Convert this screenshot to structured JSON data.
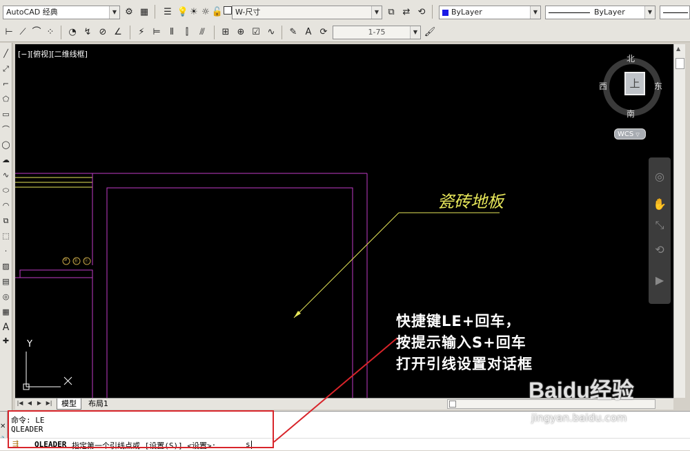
{
  "toolbar1": {
    "workspace": "AutoCAD 经典",
    "layer": "W-尺寸",
    "color": "ByLayer",
    "linetype": "ByLayer"
  },
  "toolbar2": {
    "dimstyle": "1-75"
  },
  "viewport": {
    "label": "[−][俯视][二维线框]",
    "compass": {
      "north": "北",
      "south": "南",
      "east": "东",
      "west": "西",
      "face": "上"
    },
    "wcs": "WCS",
    "axis_y": "Y",
    "leader_text": "瓷砖地板",
    "circle_labels": [
      "⑩",
      "Ⓡ",
      "Ⓣ"
    ],
    "annotation_lines": [
      "快捷键LE+回车，",
      "按提示输入S+回车",
      "打开引线设置对话框"
    ]
  },
  "tabs": {
    "model": "模型",
    "layout1": "布局1"
  },
  "command": {
    "history": [
      "命令: LE",
      "QLEADER"
    ],
    "prompt_name": "QLEADER",
    "prompt_text": "指定第一个引线点或 [设置(S)] <设置>:",
    "input_value": "s"
  },
  "watermark": {
    "brand": "Baidu经验",
    "url": "jingyan.baidu.com"
  },
  "colors": {
    "magenta": "#c23cc8",
    "yellow": "#e8e85a",
    "red": "#d8242a"
  }
}
